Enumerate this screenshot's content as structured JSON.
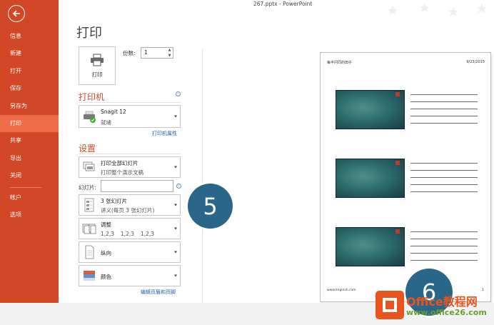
{
  "window": {
    "title": "267.pptx - PowerPoint"
  },
  "sidebar": {
    "items": [
      {
        "label": "信息"
      },
      {
        "label": "新建"
      },
      {
        "label": "打开"
      },
      {
        "label": "保存"
      },
      {
        "label": "另存为"
      },
      {
        "label": "打印",
        "active": true
      },
      {
        "label": "共享"
      },
      {
        "label": "导出"
      },
      {
        "label": "关闭"
      },
      {
        "label": "帐户"
      },
      {
        "label": "选项"
      }
    ],
    "accent_color": "#d24726",
    "active_color": "#ed6d47"
  },
  "main": {
    "title": "打印",
    "print_button_label": "打印",
    "copies_label": "份数:",
    "copies_value": "1",
    "printer": {
      "heading": "打印机",
      "name": "Snagit 12",
      "status": "就绪",
      "properties_link": "打印机属性"
    },
    "settings": {
      "heading": "设置",
      "range": {
        "title": "打印全部幻灯片",
        "subtitle": "打印整个演示文稿"
      },
      "slides_label": "幻灯片:",
      "slides_value": "",
      "layout": {
        "title": "3 张幻灯片",
        "subtitle": "讲义(每页 3 张幻灯片)"
      },
      "collate": {
        "title": "调整",
        "pages": [
          "1,2,3",
          "1,2,3",
          "1,2,3"
        ]
      },
      "orientation": {
        "title": "纵向"
      },
      "color": {
        "title": "颜色"
      },
      "header_footer_link": "编辑页眉和页脚"
    }
  },
  "badges": [
    "5",
    "6"
  ],
  "preview": {
    "header_left": "每半问同的田子",
    "header_right": "9/23/2015",
    "footer_left": "www.linginsh.com",
    "footer_right": "1"
  },
  "watermark": {
    "brand": "Office教程网",
    "url": "www.office26.com",
    "color": "#e8541e"
  }
}
